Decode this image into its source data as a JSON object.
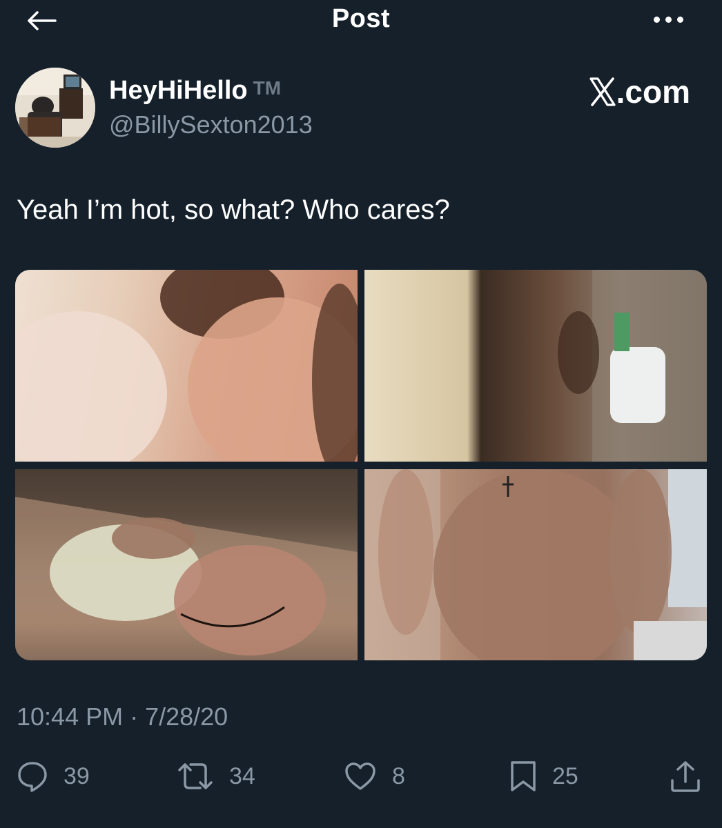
{
  "header": {
    "title": "Post",
    "back_icon": "arrow-left-icon",
    "more_icon": "more-horizontal-icon"
  },
  "author": {
    "name": "HeyHiHello",
    "badge": "TM",
    "handle": "@BillySexton2013"
  },
  "source": {
    "label": ".com",
    "logo": "x-logo-icon"
  },
  "tweet": {
    "text": "Yeah I’m hot, so what? Who cares?",
    "timestamp": "10:44 PM · 7/28/20",
    "media_count": 4
  },
  "actions": {
    "replies": "39",
    "reposts": "34",
    "likes": "8",
    "bookmarks": "25"
  },
  "colors": {
    "background": "#15202b",
    "text": "#ffffff",
    "secondary": "#8b98a5"
  }
}
